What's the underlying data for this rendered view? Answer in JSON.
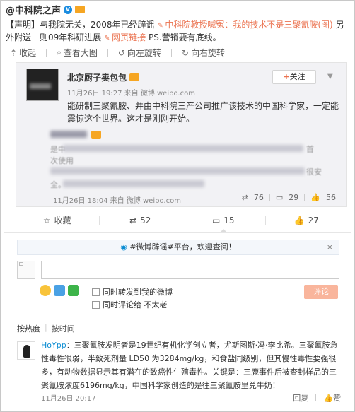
{
  "post": {
    "author": "@中科院之声",
    "text_prefix": "【声明】与我院无关，2008年已经辟谣",
    "link1": "中科院教授喊冤：我的技术不是三聚氰胺(图)",
    "text_mid": "另外附送一则09年科研进展",
    "link2": "网页链接",
    "text_suffix": "PS.营销要有底线。"
  },
  "toolbar": {
    "collapse": "收起",
    "view_large": "查看大图",
    "rotate_left": "向左旋转",
    "rotate_right": "向右旋转"
  },
  "repost": {
    "author": "北京厨子卖包包",
    "time": "11月26日 19:27",
    "source": "来自 微博 weibo.com",
    "follow": "关注",
    "text": "能研制三聚氰胺、并由中科院三产公司推广该技术的中国科学家，一定能震惊这个世界。这才是刚刚开始。",
    "nested_hint1": "是中",
    "nested_hint2": "首",
    "nested_hint3": "次使用",
    "nested_hint4": "很安",
    "nested_hint5": "全。",
    "footer_time": "11月26日 18:04",
    "footer_source": "来自 微博 weibo.com",
    "reposts": "76",
    "comments": "29",
    "likes": "56"
  },
  "actions": {
    "favorite": "收藏",
    "repost": "52",
    "comment": "15",
    "like": "27"
  },
  "comment_box": {
    "notice": "#微博辟谣#平台，欢迎查阅！",
    "notice_close": "×",
    "also_repost": "同时转发到我的微博",
    "also_comment_to": "同时评论给 不太老",
    "submit": "评论"
  },
  "sort": {
    "hot": "按热度",
    "time": "按时间"
  },
  "comment": {
    "user": "HoYpp",
    "text": "：三聚氰胺发明者是19世纪有机化学创立者，尤斯图斯·冯·李比希。三聚氰胺急性毒性很弱，半致死剂量 LD50 为3284mg/kg，和食盐同级别，但其慢性毒性要强很多，有动物数据显示其有潜在的致癌性生殖毒性。关键是：三鹿事件后被查封样品的三聚氰胺浓度6196mg/kg，中国科学家创造的是往三聚氰胺里兑牛奶！",
    "time": "11月26日 20:17",
    "reply": "回复",
    "like": "赞"
  }
}
